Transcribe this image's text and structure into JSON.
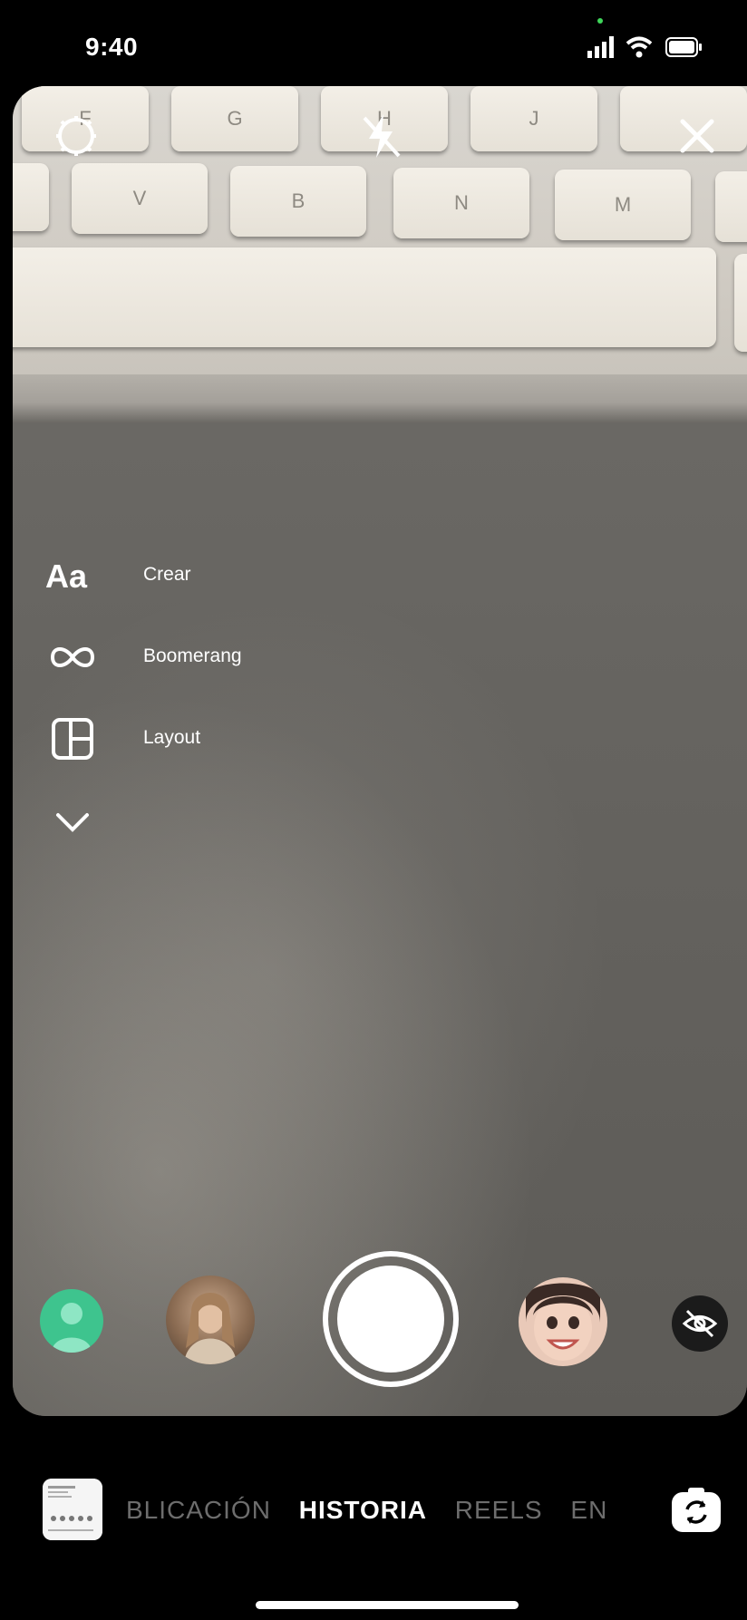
{
  "status_bar": {
    "time": "9:40"
  },
  "keyboard": {
    "keys": [
      "F",
      "G",
      "H",
      "J",
      "V",
      "B",
      "N",
      "M"
    ]
  },
  "top_controls": {
    "settings_icon": "gear-icon",
    "flash_icon": "flash-off-icon",
    "close_icon": "close-icon"
  },
  "side_menu": {
    "create": {
      "icon_text": "Aa",
      "label": "Crear"
    },
    "boomerang": {
      "icon": "infinity-icon",
      "label": "Boomerang"
    },
    "layout": {
      "icon": "layout-icon",
      "label": "Layout"
    },
    "more_icon": "chevron-down-icon"
  },
  "effects": {
    "items": [
      "green-avatar-effect",
      "portrait-effect",
      "shutter",
      "face-filter-effect",
      "hide-effect"
    ]
  },
  "modes": {
    "items": [
      "BLICACIÓN",
      "HISTORIA",
      "REELS",
      "EN"
    ],
    "active": "HISTORIA"
  },
  "colors": {
    "accent_green": "#3fd65a",
    "active_mode": "#ffffff",
    "inactive_mode": "#6d6d6d"
  }
}
